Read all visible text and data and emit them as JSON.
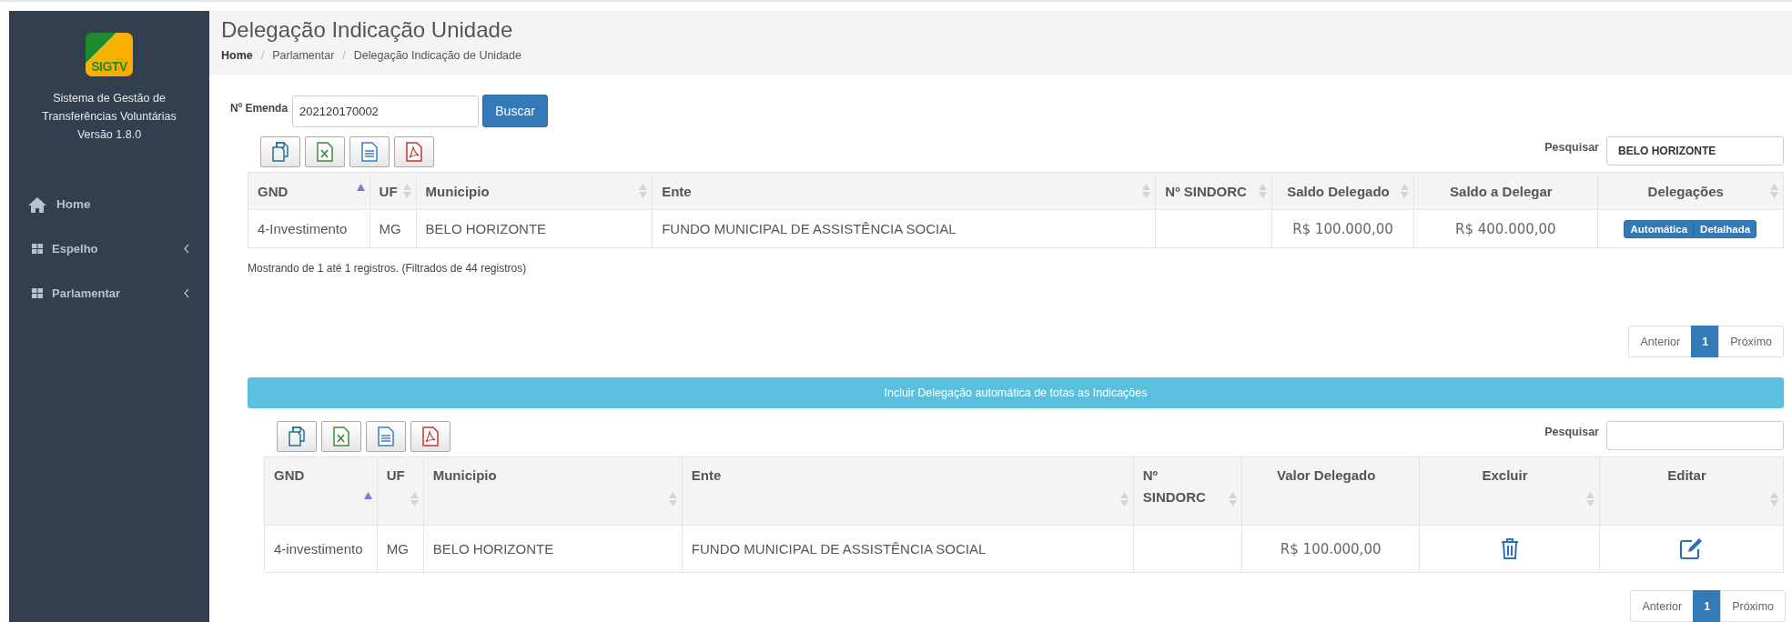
{
  "sidebar": {
    "logo_text": "SIGTV",
    "system_name": "Sistema de Gestão de Transferências Voluntárias",
    "version": "Versão 1.8.0",
    "items": [
      {
        "label": "Home",
        "kind": "link"
      },
      {
        "label": "Espelho",
        "kind": "submenu",
        "expanded": false
      },
      {
        "label": "Parlamentar",
        "kind": "submenu",
        "expanded": false
      }
    ]
  },
  "header": {
    "title": "Delegação Indicação Unidade",
    "breadcrumb": [
      "Home",
      "Parlamentar",
      "Delegação Indicação de Unidade"
    ],
    "breadcrumb_separators": [
      "/",
      "/"
    ]
  },
  "search_form": {
    "label": "Nº Emenda",
    "value": "202120170002",
    "button": "Buscar"
  },
  "table_1": {
    "search_label": "Pesquisar",
    "search_value": "BELO HORIZONTE",
    "columns": [
      {
        "label": "GND",
        "sortable": true,
        "sorted": true
      },
      {
        "label": "UF",
        "sortable": true,
        "sorted": false
      },
      {
        "label": "Municipio",
        "sortable": true,
        "sorted": false
      },
      {
        "label": "Ente",
        "sortable": true,
        "sorted": false
      },
      {
        "label": "Nº SINDORC",
        "sortable": true,
        "sorted": false
      },
      {
        "label": "Saldo Delegado",
        "sortable": true,
        "sorted": false
      },
      {
        "label": "Saldo a Delegar",
        "sortable": false,
        "sorted": false
      },
      {
        "label": "Delegações",
        "sortable": true,
        "sorted": false
      }
    ],
    "rows": [
      {
        "cells": [
          {
            "kind": "text",
            "text": "4-Investimento"
          },
          {
            "kind": "text",
            "text": "MG"
          },
          {
            "kind": "text",
            "text": "BELO HORIZONTE"
          },
          {
            "kind": "text",
            "text": "FUNDO MUNICIPAL DE ASSISTÊNCIA SOCIAL"
          },
          {
            "kind": "empty"
          },
          {
            "kind": "money",
            "text": "R$ 100.000,00"
          },
          {
            "kind": "money",
            "text": "R$ 400.000,00"
          },
          {
            "kind": "buttons",
            "buttons": [
              "Automática",
              "Detalhada"
            ]
          }
        ]
      }
    ],
    "info": "Mostrando de 1 até 1  registros. (Filtrados de 44 registros)",
    "pagination": [
      {
        "label": "Anterior",
        "selected": false
      },
      {
        "label": "1",
        "selected": true
      },
      {
        "label": "Próximo",
        "selected": false
      }
    ]
  },
  "include_bar": "Incluir Delegação automática de totas as Indicações",
  "table_2": {
    "search_label": "Pesquisar",
    "columns": [
      {
        "label": "GND",
        "sortable": true,
        "sorted": true
      },
      {
        "label": "UF",
        "sortable": true,
        "sorted": false
      },
      {
        "label": "Municipio",
        "sortable": true,
        "sorted": false
      },
      {
        "label": "Ente",
        "sortable": true,
        "sorted": false
      },
      {
        "label": "Nº SINDORC",
        "sortable": true,
        "sorted": false
      },
      {
        "label": "Valor Delegado",
        "sortable": false,
        "sorted": false
      },
      {
        "label": "Excluir",
        "sortable": true,
        "sorted": false
      },
      {
        "label": "Editar",
        "sortable": true,
        "sorted": false
      }
    ],
    "rows": [
      {
        "cells": [
          {
            "kind": "text",
            "text": "4-investimento"
          },
          {
            "kind": "text",
            "text": "MG"
          },
          {
            "kind": "text",
            "text": "BELO HORIZONTE"
          },
          {
            "kind": "text",
            "text": "FUNDO MUNICIPAL DE ASSISTÊNCIA SOCIAL"
          },
          {
            "kind": "empty"
          },
          {
            "kind": "money",
            "text": "R$ 100.000,00"
          },
          {
            "kind": "delete"
          },
          {
            "kind": "edit"
          }
        ]
      }
    ],
    "pagination": [
      {
        "label": "Anterior",
        "selected": false
      },
      {
        "label": "1",
        "selected": true
      },
      {
        "label": "Próximo",
        "selected": false
      }
    ]
  }
}
